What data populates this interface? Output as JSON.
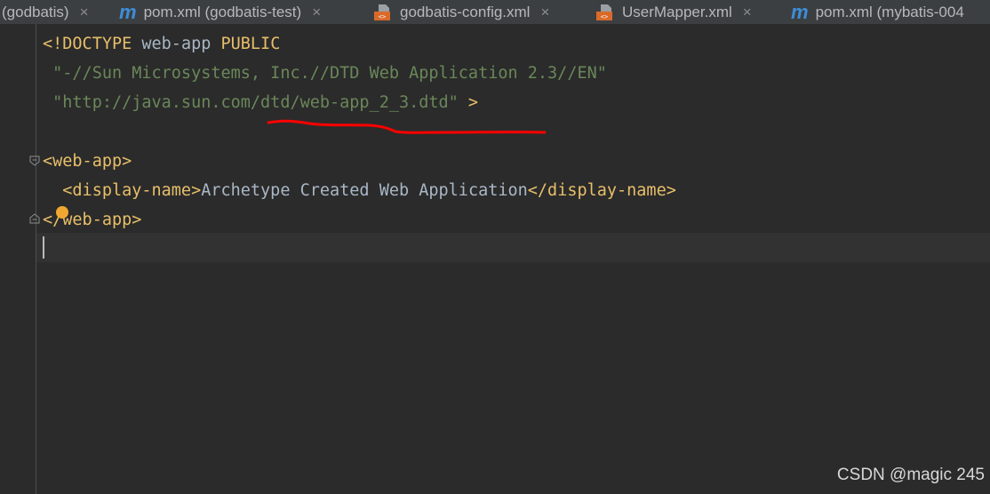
{
  "tabs": [
    {
      "label": "(godbatis)",
      "icon": "none",
      "closable": true
    },
    {
      "label": "pom.xml (godbatis-test)",
      "icon": "maven-icon",
      "closable": true
    },
    {
      "label": "godbatis-config.xml",
      "icon": "xml-file-icon",
      "closable": true
    },
    {
      "label": "UserMapper.xml",
      "icon": "xml-file-icon",
      "closable": true
    },
    {
      "label": "pom.xml (mybatis-004",
      "icon": "maven-icon",
      "closable": false
    }
  ],
  "tab_close_glyph": "×",
  "maven_glyph": "m",
  "code": {
    "line1": {
      "open": "<!",
      "doctype": "DOCTYPE",
      "name": " web-app ",
      "public": "PUBLIC"
    },
    "line2": {
      "indent": " ",
      "string": "\"-//Sun Microsystems, Inc.//DTD Web Application 2.3//EN\""
    },
    "line3": {
      "indent": " ",
      "string": "\"http://java.sun.com/dtd/web-app_2_3.dtd\"",
      "close": " >"
    },
    "line5": {
      "tag": "<web-app>"
    },
    "line6": {
      "indent": "  ",
      "open_tag": "<display-name>",
      "text": "Archetype Created Web Application",
      "close_tag": "</display-name>"
    },
    "line7": {
      "tag": "</web-app>"
    }
  },
  "colors": {
    "background": "#2b2b2b",
    "tag": "#e8bf6a",
    "string": "#6a8759",
    "text": "#a9b7c6",
    "annotation_underline": "#ff0000",
    "intention_bulb": "#f0a732"
  },
  "watermark": "CSDN @magic 245"
}
